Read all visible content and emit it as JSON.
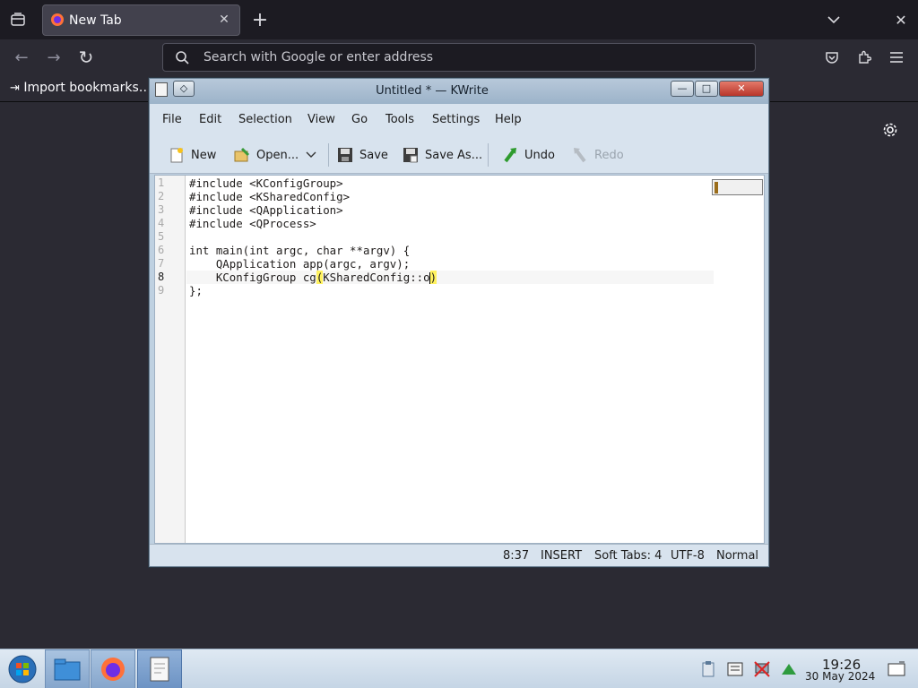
{
  "browser": {
    "tab_title": "New Tab",
    "tab_close": "✕",
    "new_tab": "+",
    "list_all_tabs": "⌵",
    "window_close": "✕",
    "back": "←",
    "forward": "→",
    "reload": "↻",
    "url_placeholder": "Search with Google or enter address",
    "bookmark_import": "Import bookmarks…",
    "colors": {
      "bg": "#1c1b22",
      "toolbar": "#2b2a33",
      "accent": "#ff7139"
    }
  },
  "kwrite": {
    "title": "Untitled * — KWrite",
    "window_buttons": {
      "minimize": "—",
      "maximize": "□",
      "close": "✕"
    },
    "menu": [
      "File",
      "Edit",
      "Selection",
      "View",
      "Go",
      "Tools",
      "Settings",
      "Help"
    ],
    "toolbar": {
      "new": "New",
      "open": "Open...",
      "save": "Save",
      "save_as": "Save As...",
      "undo": "Undo",
      "redo": "Redo"
    },
    "line_numbers": [
      "1",
      "2",
      "3",
      "4",
      "5",
      "6",
      "7",
      "8",
      "9"
    ],
    "code": {
      "l1": "#include <KConfigGroup>",
      "l2": "#include <KSharedConfig>",
      "l3": "#include <QApplication>",
      "l4": "#include <QProcess>",
      "l5": "",
      "l6": "int main(int argc, char **argv) {",
      "l7": "    QApplication app(argc, argv);",
      "l8_before": "    KConfigGroup cg",
      "l8_open": "(",
      "l8_mid": "KSharedConfig::o",
      "l8_close": ")",
      "l9": "};"
    },
    "status": {
      "cursor": "8:37",
      "mode": "INSERT",
      "indent": "Soft Tabs: 4",
      "encoding": "UTF-8",
      "input_mode": "Normal"
    }
  },
  "taskbar": {
    "clock_time": "19:26",
    "clock_date": "30 May 2024"
  }
}
